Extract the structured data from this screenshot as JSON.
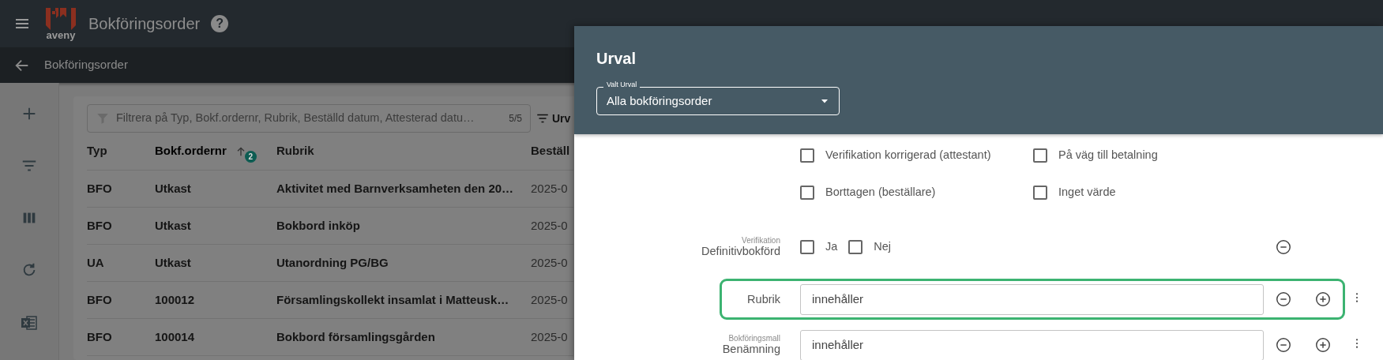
{
  "app_bar": {
    "logo_text": "aveny",
    "title": "Bokföringsorder",
    "help": "?"
  },
  "sub_bar": {
    "title": "Bokföringsorder"
  },
  "filter": {
    "placeholder": "Filtrera på Typ, Bokf.ordernr, Rubrik, Beställd datum, Attesterad datu…",
    "count": "5/5"
  },
  "urval_button": "Urv",
  "table": {
    "columns": [
      {
        "label": "Typ",
        "sorted": false
      },
      {
        "label": "Bokf.ordernr",
        "sorted": true,
        "sort_rank": "2"
      },
      {
        "label": "Rubrik",
        "sorted": false
      },
      {
        "label": "Beställ",
        "sorted": false
      }
    ],
    "rows": [
      [
        "BFO",
        "Utkast",
        "Aktivitet med Barnverksamheten den 20…",
        "2025-0"
      ],
      [
        "BFO",
        "Utkast",
        "Bokbord inköp",
        "2025-0"
      ],
      [
        "UA",
        "Utkast",
        "Utanordning PG/BG",
        "2025-0"
      ],
      [
        "BFO",
        "100012",
        "Församlingskollekt insamlat i Matteusk…",
        "2025-0"
      ],
      [
        "BFO",
        "100014",
        "Bokbord församlingsgården",
        "2025-0"
      ]
    ]
  },
  "panel": {
    "title": "Urval",
    "select": {
      "label": "Valt Urval",
      "value": "Alla bokföringsorder"
    },
    "filters": [
      {
        "kind": "checkboxes",
        "options": [
          {
            "label": "Verifikation korrigerad (attestant)",
            "checked": false
          },
          {
            "label": "På väg till betalning",
            "checked": false
          },
          {
            "label": "Borttagen (beställare)",
            "checked": false
          },
          {
            "label": "Inget värde",
            "checked": false
          }
        ]
      },
      {
        "kind": "checkbox_row",
        "sublabel": "Verifikation",
        "label": "Definitivbokförd",
        "highlighted": false,
        "removable": true,
        "addable": false,
        "menu": false,
        "options": [
          {
            "label": "Ja",
            "checked": false
          },
          {
            "label": "Nej",
            "checked": false
          }
        ]
      },
      {
        "kind": "text",
        "label": "Rubrik",
        "value": "innehåller",
        "highlighted": true,
        "removable": true,
        "addable": true,
        "menu": true
      },
      {
        "kind": "text",
        "sublabel": "Bokföringsmall",
        "label": "Benämning",
        "value": "innehåller",
        "highlighted": false,
        "removable": true,
        "addable": true,
        "menu": true
      }
    ]
  }
}
